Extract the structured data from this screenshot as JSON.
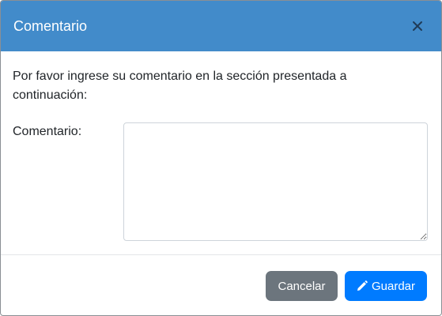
{
  "dialog": {
    "title": "Comentario",
    "close_icon": "close-icon",
    "intro_text": "Por favor ingrese su comentario en la sección presentada a continuación:",
    "comment_label": "Comentario:",
    "comment_value": ""
  },
  "footer": {
    "cancel_label": "Cancelar",
    "save_label": "Guardar",
    "save_icon": "pencil-icon"
  },
  "colors": {
    "header": "#428bca",
    "cancel": "#6c757d",
    "save": "#007bff"
  }
}
